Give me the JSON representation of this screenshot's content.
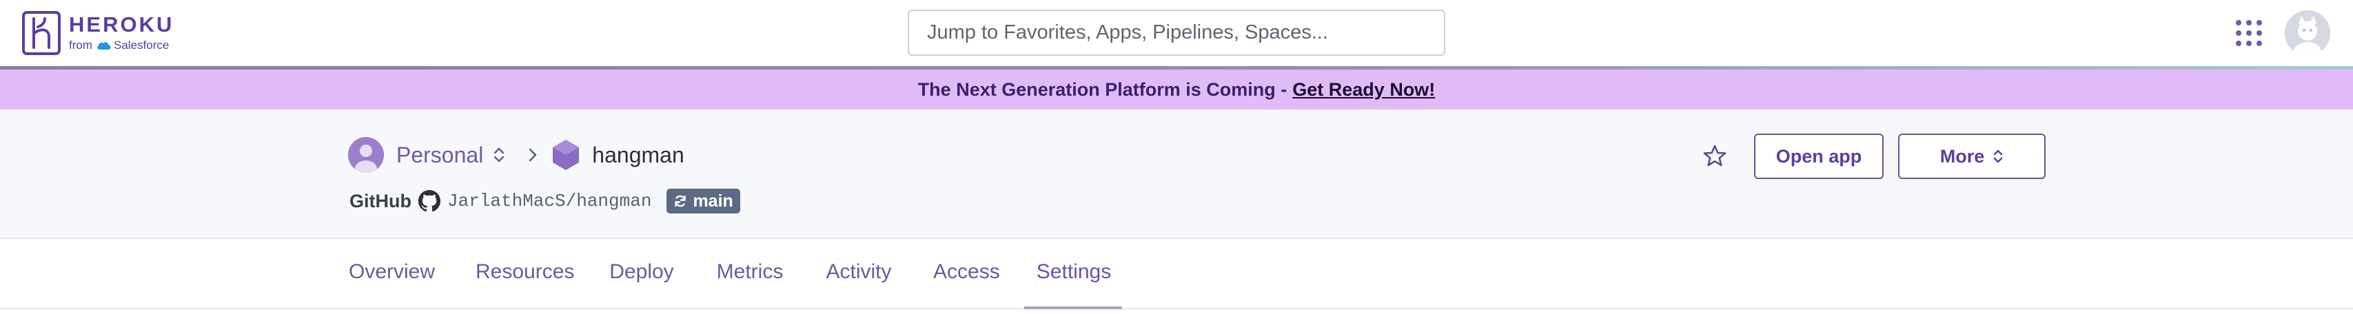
{
  "brand": {
    "name": "HEROKU",
    "from_label": "from",
    "parent": "Salesforce"
  },
  "search": {
    "placeholder": "Jump to Favorites, Apps, Pipelines, Spaces..."
  },
  "icons": {
    "apps_menu": "apps-grid-icon",
    "account": "user-avatar"
  },
  "banner": {
    "text": "The Next Generation Platform is Coming - ",
    "link": "Get Ready Now!",
    "background": "#e1bbf7"
  },
  "app_header": {
    "owner": "Personal",
    "app_name": "hangman",
    "github_label": "GitHub",
    "repo": "JarlathMacS/hangman",
    "branch": "main",
    "open_app_label": "Open app",
    "more_label": "More"
  },
  "tabs": [
    {
      "label": "Overview"
    },
    {
      "label": "Resources"
    },
    {
      "label": "Deploy"
    },
    {
      "label": "Metrics"
    },
    {
      "label": "Activity"
    },
    {
      "label": "Access"
    },
    {
      "label": "Settings",
      "active": true
    }
  ],
  "colors": {
    "accent": "#5a3ea2",
    "tab_text": "#6b5a98",
    "header_bg": "#f7f8fb"
  }
}
